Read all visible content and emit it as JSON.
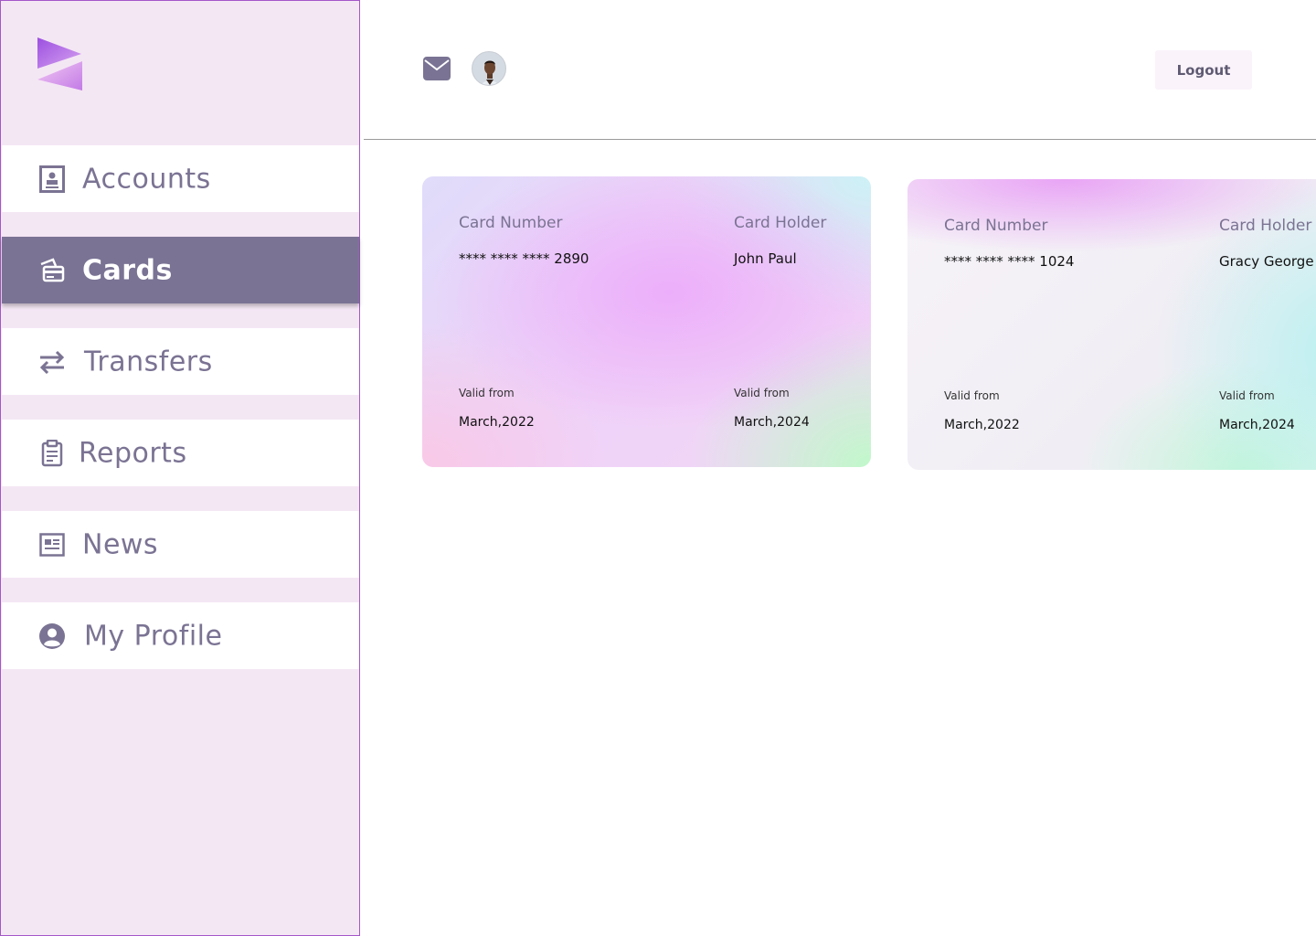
{
  "sidebar": {
    "items": [
      {
        "label": "Accounts",
        "icon": "id-card-icon"
      },
      {
        "label": "Cards",
        "icon": "credit-card-icon"
      },
      {
        "label": "Transfers",
        "icon": "transfer-arrows-icon"
      },
      {
        "label": "Reports",
        "icon": "clipboard-icon"
      },
      {
        "label": "News",
        "icon": "newspaper-icon"
      },
      {
        "label": "My Profile",
        "icon": "user-circle-icon"
      }
    ],
    "active": "Cards"
  },
  "header": {
    "mail_icon": "mail-icon",
    "avatar": "user-avatar",
    "logout_label": "Logout"
  },
  "cards": [
    {
      "number_label": "Card Number",
      "number": "**** **** **** 2890",
      "holder_label": "Card Holder",
      "holder": "John Paul",
      "valid_from_label": "Valid from",
      "valid_from": "March,2022",
      "valid_to_label": "Valid from",
      "valid_to": "March,2024"
    },
    {
      "number_label": "Card Number",
      "number": "**** **** **** 1024",
      "holder_label": "Card Holder",
      "holder": "Gracy George",
      "valid_from_label": "Valid from",
      "valid_from": "March,2022",
      "valid_to_label": "Valid from",
      "valid_to": "March,2024"
    }
  ],
  "colors": {
    "sidebar_bg": "#f4e7f4",
    "accent": "#7a7394",
    "text_muted": "#7b7393"
  }
}
